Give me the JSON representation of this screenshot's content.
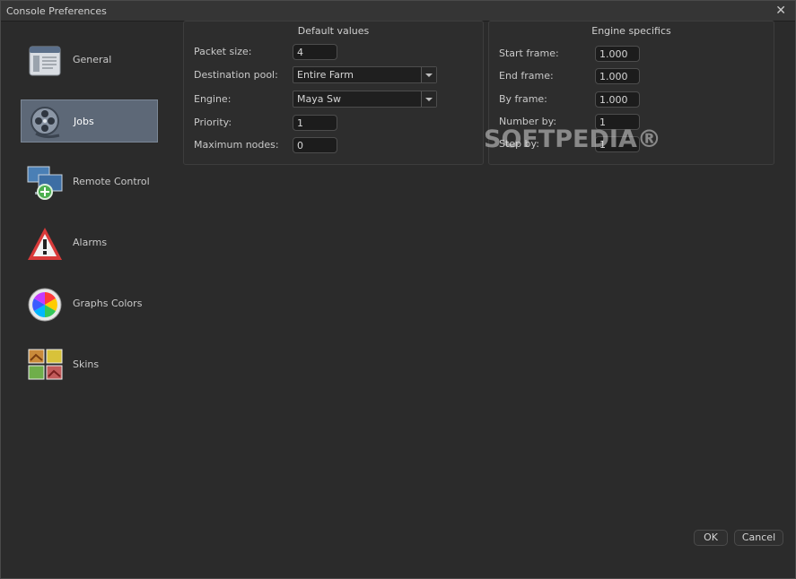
{
  "window": {
    "title": "Console Preferences",
    "close_glyph": "✕"
  },
  "sidebar": {
    "items": [
      {
        "label": "General",
        "icon": "window-icon"
      },
      {
        "label": "Jobs",
        "icon": "film-reel-icon",
        "active": true
      },
      {
        "label": "Remote Control",
        "icon": "remote-monitors-icon"
      },
      {
        "label": "Alarms",
        "icon": "warning-icon"
      },
      {
        "label": "Graphs Colors",
        "icon": "color-wheel-icon"
      },
      {
        "label": "Skins",
        "icon": "skins-icon"
      }
    ]
  },
  "default_values": {
    "title": "Default values",
    "packet_size": {
      "label": "Packet size:",
      "value": "4"
    },
    "destination_pool": {
      "label": "Destination pool:",
      "value": "Entire Farm"
    },
    "engine": {
      "label": "Engine:",
      "value": "Maya Sw"
    },
    "priority": {
      "label": "Priority:",
      "value": "1"
    },
    "maximum_nodes": {
      "label": "Maximum nodes:",
      "value": "0"
    }
  },
  "engine_specifics": {
    "title": "Engine specifics",
    "start_frame": {
      "label": "Start frame:",
      "value": "1.000"
    },
    "end_frame": {
      "label": "End frame:",
      "value": "1.000"
    },
    "by_frame": {
      "label": "By frame:",
      "value": "1.000"
    },
    "number_by": {
      "label": "Number by:",
      "value": "1"
    },
    "step_by": {
      "label": "Step by:",
      "value": "1"
    }
  },
  "buttons": {
    "ok": "OK",
    "cancel": "Cancel"
  },
  "watermark": "SOFTPEDIA®",
  "colors": {
    "background": "#2b2b2b",
    "active_item": "#5d6877",
    "field_bg": "#1c1c1c"
  }
}
